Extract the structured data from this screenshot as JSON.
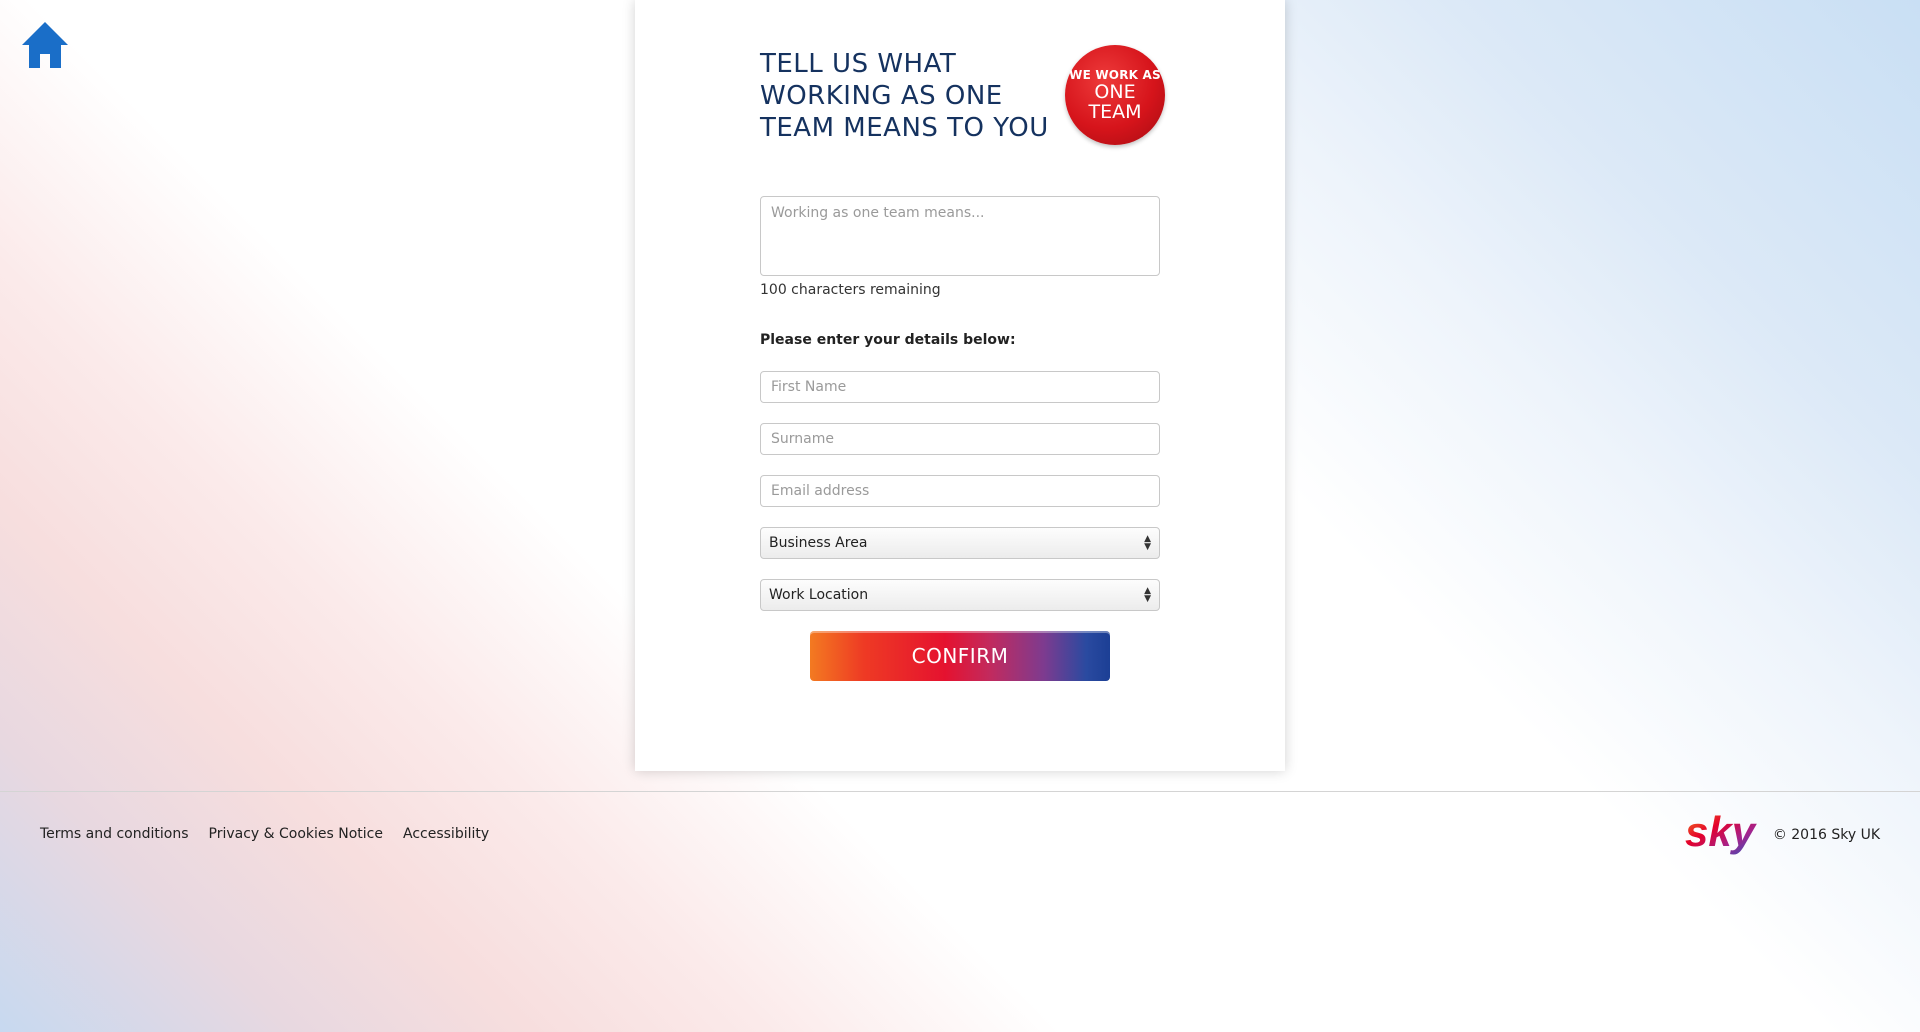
{
  "header": {
    "title": "TELL US WHAT WORKING AS ONE TEAM MEANS TO YOU",
    "badge_line1": "WE WORK AS",
    "badge_line2": "ONE TEAM"
  },
  "form": {
    "message_placeholder": "Working as one team means...",
    "message_value": "",
    "characters_remaining": "100 characters remaining",
    "details_label": "Please enter your details below:",
    "first_name_placeholder": "First Name",
    "surname_placeholder": "Surname",
    "email_placeholder": "Email address",
    "business_area_selected": "Business Area",
    "work_location_selected": "Work Location",
    "confirm_label": "CONFIRM"
  },
  "footer": {
    "links": [
      "Terms and conditions",
      "Privacy & Cookies Notice",
      "Accessibility"
    ],
    "logo_text": "sky",
    "copyright": "© 2016 Sky UK"
  },
  "colors": {
    "home_icon": "#1a6ec8",
    "headline": "#15325f",
    "badge": "#d6141b"
  },
  "icons": {
    "home": "home-icon",
    "select_arrows": "sort-arrows-icon"
  }
}
